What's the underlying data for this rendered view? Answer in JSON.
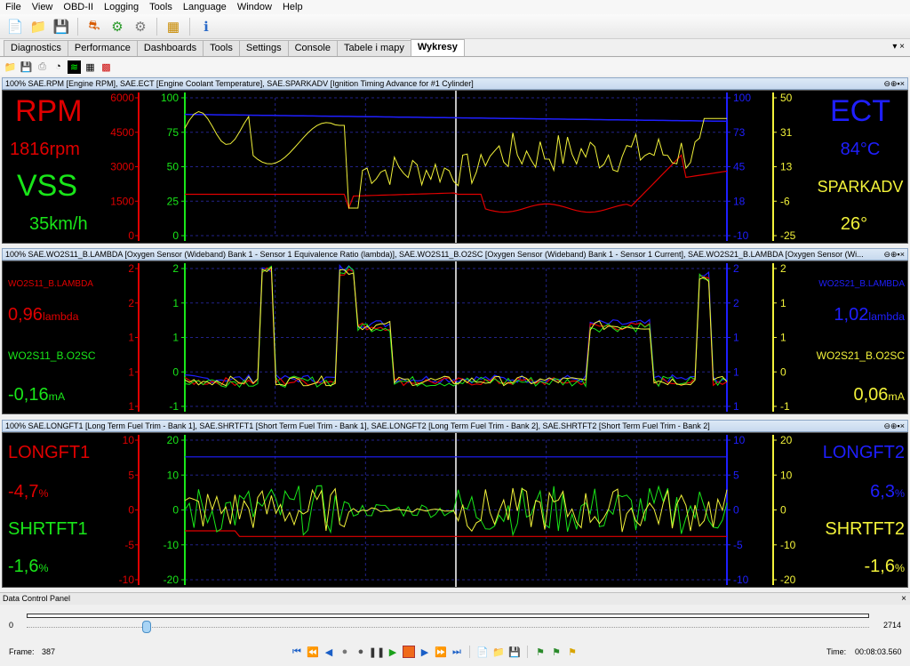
{
  "menu": [
    "File",
    "View",
    "OBD-II",
    "Logging",
    "Tools",
    "Language",
    "Window",
    "Help"
  ],
  "toolbar_icons": [
    "new-file-icon",
    "open-folder-icon",
    "save-icon",
    "print-icon",
    "car-icon",
    "connect-icon",
    "disconnect-icon",
    "settings-frame-icon",
    "info-icon"
  ],
  "tabs": [
    "Diagnostics",
    "Performance",
    "Dashboards",
    "Tools",
    "Settings",
    "Console",
    "Tabele i mapy",
    "Wykresy"
  ],
  "active_tab": "Wykresy",
  "tab_controls": "▾ ×",
  "panel_controls": "⊖⊕▪×",
  "panels": [
    {
      "title": "100% SAE.RPM [Engine RPM], SAE.ECT [Engine Coolant Temperature], SAE.SPARKADV [Ignition Timing Advance for #1 Cylinder]",
      "left": {
        "name1": "RPM",
        "value1": "1816rpm",
        "name2": "VSS",
        "value2": "35km/h"
      },
      "right": {
        "name1": "ECT",
        "value1": "84°C",
        "name2": "SPARKADV",
        "value2": "26°"
      },
      "axis_red": [
        "6000",
        "4500",
        "3000",
        "1500",
        "0"
      ],
      "axis_green": [
        "100",
        "75",
        "50",
        "25",
        "0"
      ],
      "axis_blue": [
        "100",
        "73",
        "45",
        "18",
        "-10"
      ],
      "axis_yellow": [
        "50",
        "31",
        "13",
        "-6",
        "-25"
      ]
    },
    {
      "title": "100% SAE.WO2S11_B.LAMBDA [Oxygen Sensor (Wideband) Bank 1 - Sensor 1 Equivalence Ratio (lambda)], SAE.WO2S11_B.O2SC [Oxygen Sensor (Wideband) Bank 1 - Sensor 1 Current], SAE.WO2S21_B.LAMBDA [Oxygen Sensor (Wi...",
      "left": {
        "name1": "WO2S11_B.LAMBDA",
        "value1": "0,96",
        "unit1": "lambda",
        "name2": "WO2S11_B.O2SC",
        "value2": "-0,16",
        "unit2": "mA"
      },
      "right": {
        "name1": "WO2S21_B.LAMBDA",
        "value1": "1,02",
        "unit1": "lambda",
        "name2": "WO2S21_B.O2SC",
        "value2": "0,06",
        "unit2": "mA"
      },
      "axis_red": [
        "2",
        "2",
        "1",
        "1",
        "1"
      ],
      "axis_green": [
        "2",
        "1",
        "1",
        "0",
        "-1"
      ],
      "axis_blue": [
        "2",
        "2",
        "1",
        "1",
        "1"
      ],
      "axis_yellow": [
        "2",
        "1",
        "1",
        "0",
        "-1"
      ]
    },
    {
      "title": "100% SAE.LONGFT1 [Long Term Fuel Trim - Bank 1], SAE.SHRTFT1 [Short Term Fuel Trim - Bank 1], SAE.LONGFT2 [Long Term Fuel Trim - Bank 2], SAE.SHRTFT2 [Short Term Fuel Trim - Bank 2]",
      "left": {
        "name1": "LONGFT1",
        "value1": "-4,7",
        "unit1": "%",
        "name2": "SHRTFT1",
        "value2": "-1,6",
        "unit2": "%"
      },
      "right": {
        "name1": "LONGFT2",
        "value1": "6,3",
        "unit1": "%",
        "name2": "SHRTFT2",
        "value2": "-1,6",
        "unit2": "%"
      },
      "axis_red": [
        "10",
        "5",
        "0",
        "-5",
        "-10"
      ],
      "axis_green": [
        "20",
        "10",
        "0",
        "-10",
        "-20"
      ],
      "axis_blue": [
        "10",
        "5",
        "0",
        "-5",
        "-10"
      ],
      "axis_yellow": [
        "20",
        "10",
        "0",
        "-10",
        "-20"
      ]
    }
  ],
  "colors": {
    "red": "#e00000",
    "green": "#19e619",
    "blue": "#1f1fff",
    "yellow": "#f2f23a"
  },
  "dcp": {
    "title": "Data Control Panel",
    "close": "×",
    "min": "0",
    "max": "2714",
    "position": 387,
    "frame_label": "Frame:",
    "frame_value": "387",
    "time_label": "Time:",
    "time_value": "00:08:03.560"
  }
}
